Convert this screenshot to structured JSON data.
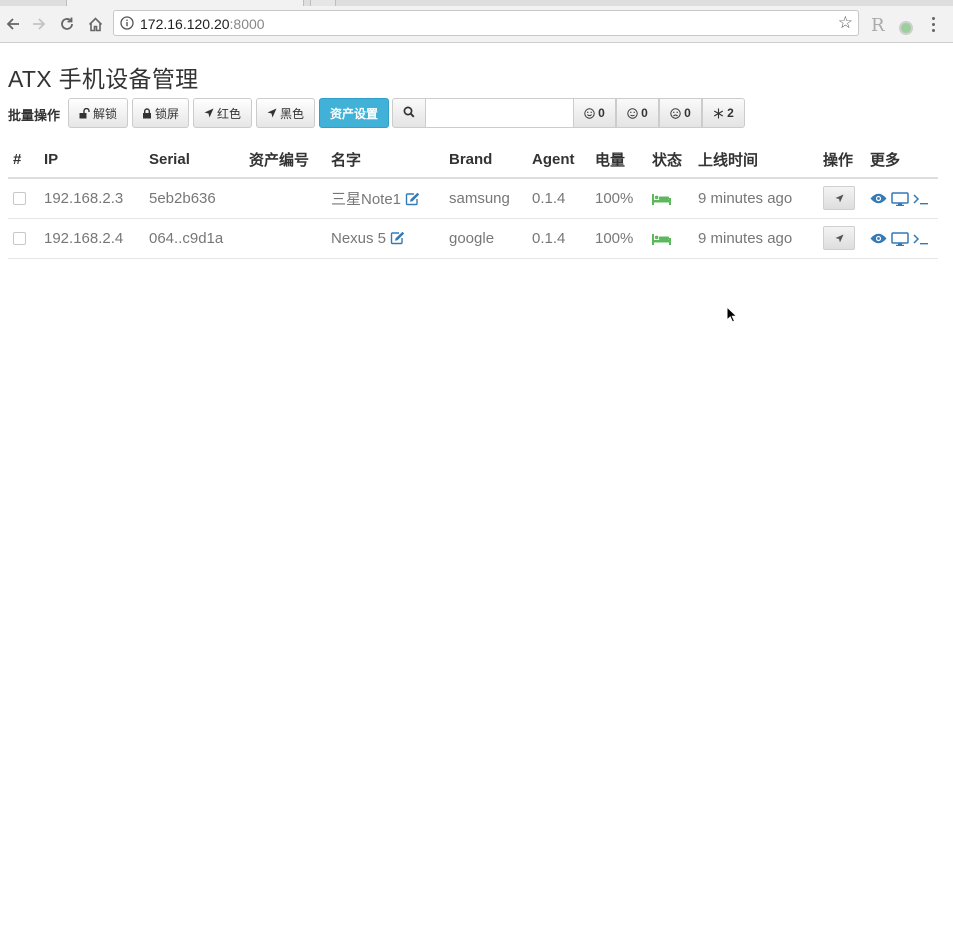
{
  "browser": {
    "address_host": "172.16.120.20",
    "address_port": ":8000",
    "extension_letter": "R",
    "icons": {
      "back": "arrow-left-icon",
      "forward": "arrow-right-icon",
      "reload": "reload-icon",
      "home": "home-icon",
      "info": "info-circle-icon",
      "bookmark": "star-icon",
      "menu": "vertical-dots-icon"
    }
  },
  "page": {
    "title": "ATX 手机设备管理",
    "batch_label": "批量操作",
    "buttons": {
      "unlock": "解锁",
      "lock": "锁屏",
      "red": "红色",
      "black": "黑色",
      "asset": "资产设置"
    },
    "search": {
      "value": "",
      "placeholder": ""
    },
    "counts": [
      {
        "icon": "smile-icon",
        "value": "0"
      },
      {
        "icon": "neutral-face-icon",
        "value": "0"
      },
      {
        "icon": "frown-icon",
        "value": "0"
      },
      {
        "icon": "snowflake-icon",
        "value": "2"
      }
    ]
  },
  "table": {
    "headers": [
      "#",
      "IP",
      "Serial",
      "资产编号",
      "名字",
      "Brand",
      "Agent",
      "电量",
      "状态",
      "上线时间",
      "操作",
      "更多"
    ],
    "rows": [
      {
        "ip": "192.168.2.3",
        "serial": "5eb2b636",
        "asset": "",
        "name": "三星Note1",
        "brand": "samsung",
        "agent": "0.1.4",
        "battery": "100%",
        "status_icon": "bed-icon",
        "online": "9 minutes ago"
      },
      {
        "ip": "192.168.2.4",
        "serial": "064..c9d1a",
        "asset": "",
        "name": "Nexus 5",
        "brand": "google",
        "agent": "0.1.4",
        "battery": "100%",
        "status_icon": "bed-icon",
        "online": "9 minutes ago"
      }
    ]
  },
  "colors": {
    "primary": "#41b1d8",
    "link": "#337ab7",
    "status_green": "#5cb85c"
  }
}
